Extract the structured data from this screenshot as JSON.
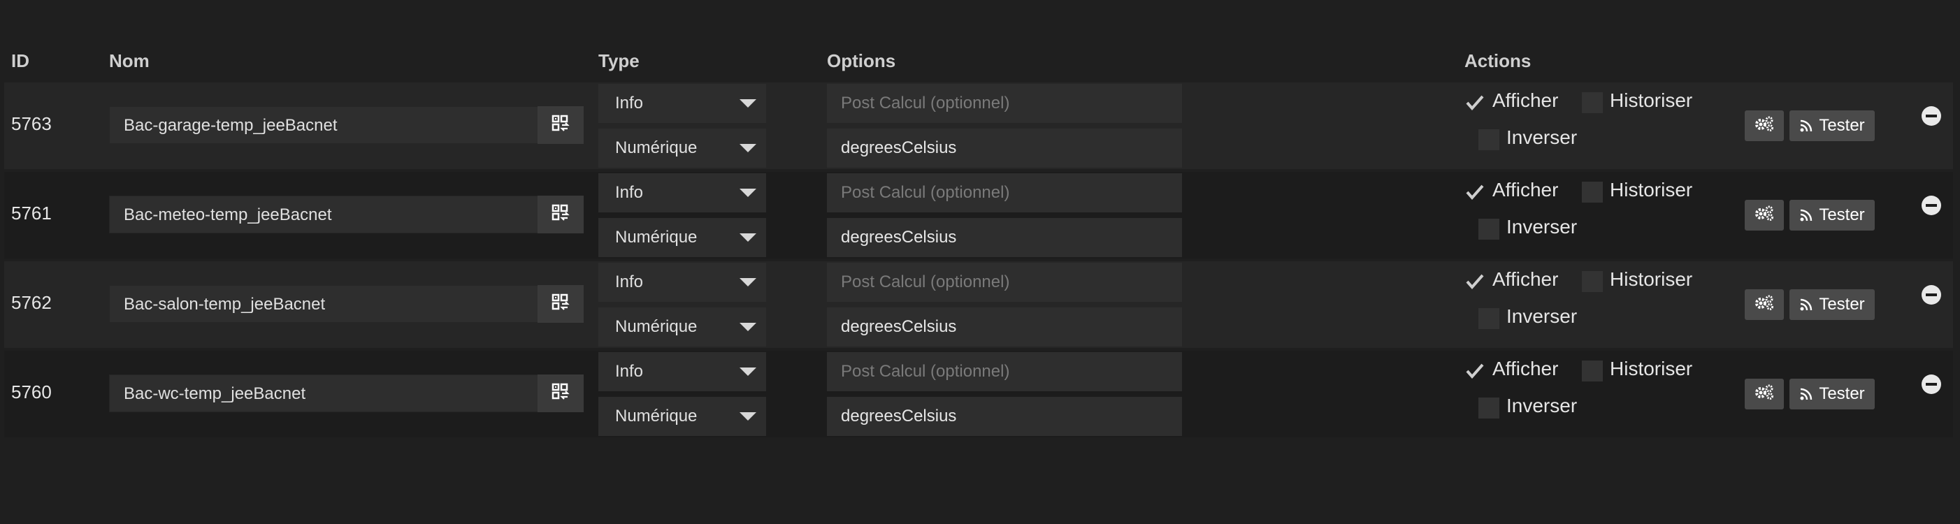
{
  "headers": {
    "id": "ID",
    "nom": "Nom",
    "type": "Type",
    "options": "Options",
    "actions": "Actions"
  },
  "rows": [
    {
      "id": "5763",
      "name": "Bac-garage-temp_jeeBacnet",
      "type": "Info",
      "subtype": "Numérique",
      "post_calcul_placeholder": "Post Calcul (optionnel)",
      "unit": "degreesCelsius",
      "afficher": "Afficher",
      "afficher_checked": true,
      "historiser": "Historiser",
      "historiser_checked": false,
      "inverser": "Inverser",
      "inverser_checked": false,
      "tester": "Tester"
    },
    {
      "id": "5761",
      "name": "Bac-meteo-temp_jeeBacnet",
      "type": "Info",
      "subtype": "Numérique",
      "post_calcul_placeholder": "Post Calcul (optionnel)",
      "unit": "degreesCelsius",
      "afficher": "Afficher",
      "afficher_checked": true,
      "historiser": "Historiser",
      "historiser_checked": false,
      "inverser": "Inverser",
      "inverser_checked": false,
      "tester": "Tester"
    },
    {
      "id": "5762",
      "name": "Bac-salon-temp_jeeBacnet",
      "type": "Info",
      "subtype": "Numérique",
      "post_calcul_placeholder": "Post Calcul (optionnel)",
      "unit": "degreesCelsius",
      "afficher": "Afficher",
      "afficher_checked": true,
      "historiser": "Historiser",
      "historiser_checked": false,
      "inverser": "Inverser",
      "inverser_checked": false,
      "tester": "Tester"
    },
    {
      "id": "5760",
      "name": "Bac-wc-temp_jeeBacnet",
      "type": "Info",
      "subtype": "Numérique",
      "post_calcul_placeholder": "Post Calcul (optionnel)",
      "unit": "degreesCelsius",
      "afficher": "Afficher",
      "afficher_checked": true,
      "historiser": "Historiser",
      "historiser_checked": false,
      "inverser": "Inverser",
      "inverser_checked": false,
      "tester": "Tester"
    }
  ],
  "icons": {
    "name_button": "qr-swap-icon",
    "config_button": "gears-icon",
    "tester_button": "rss-icon",
    "remove": "minus-circle-icon",
    "checked": "check-icon"
  },
  "colors": {
    "background": "#1f1f1f",
    "row_alt": "#262626",
    "input": "#2e2e2e",
    "button": "#4a4a4a"
  }
}
